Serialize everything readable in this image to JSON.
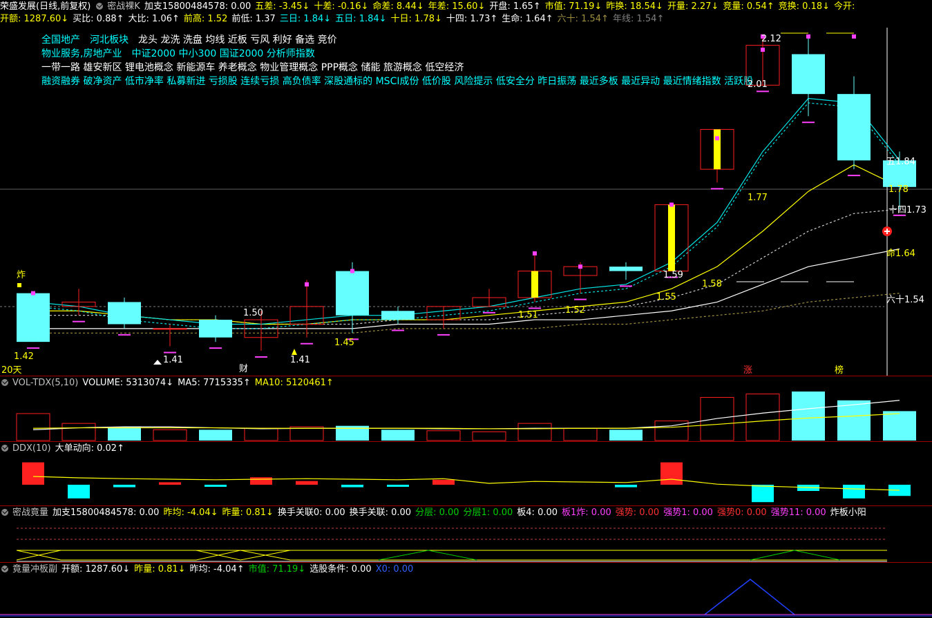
{
  "header": {
    "row1": [
      {
        "t": "荣盛发展(日线,前复权)",
        "c": "#ffffff"
      },
      {
        "icon": "circle"
      },
      {
        "t": "密战裸K",
        "c": "#c0c0c0"
      },
      {
        "t": "加支15800484578: 0.00",
        "c": "#ffffff"
      },
      {
        "t": "五差: -3.45↓",
        "c": "#ffff00"
      },
      {
        "t": "十差: -0.16↓",
        "c": "#ffff00"
      },
      {
        "t": "命差: 8.44↓",
        "c": "#ffff00"
      },
      {
        "t": "年差: 15.60↓",
        "c": "#ffff00"
      },
      {
        "t": "开盘: 1.65↑",
        "c": "#ffffff"
      },
      {
        "t": "市值: 71.19↓",
        "c": "#ffff00"
      },
      {
        "t": "昨换: 18.54↓",
        "c": "#ffff00"
      },
      {
        "t": "开量: 2.27↓",
        "c": "#ffff00"
      },
      {
        "t": "竞量: 0.54↑",
        "c": "#ffff00"
      },
      {
        "t": "竞换: 0.18↓",
        "c": "#ffff00"
      },
      {
        "t": "今开:",
        "c": "#ffff00"
      }
    ],
    "row2": [
      {
        "t": "开额: 1287.60↓",
        "c": "#ffff00"
      },
      {
        "t": "买比: 0.88↑",
        "c": "#ffffff"
      },
      {
        "t": "大比: 1.06↑",
        "c": "#ffffff"
      },
      {
        "t": "前高: 1.52",
        "c": "#ffff00"
      },
      {
        "t": "前低: 1.37",
        "c": "#ffffff"
      },
      {
        "t": "三日: 1.84↓",
        "c": "#00ffff"
      },
      {
        "t": "五日: 1.84↓",
        "c": "#00ffff"
      },
      {
        "t": "十日: 1.78↓",
        "c": "#ffff00"
      },
      {
        "t": "十四: 1.73↑",
        "c": "#ffffff"
      },
      {
        "t": "生命: 1.64↑",
        "c": "#ffffff"
      },
      {
        "t": "六十: 1.54↑",
        "c": "#a09040"
      },
      {
        "t": "年线: 1.54↑",
        "c": "#808080"
      }
    ]
  },
  "concepts": {
    "line1": [
      {
        "t": "全国地产",
        "c": "#00ffff"
      },
      {
        "t": "河北板块",
        "c": "#00ffff"
      },
      {
        "t": "龙头 龙洗 洗盘 均线 近板 亏风 利好 备选 竞价",
        "c": "#ffffff"
      }
    ],
    "line2": [
      {
        "t": "物业服务,房地产业",
        "c": "#00ffff"
      },
      {
        "t": "中证2000 中小300 国证2000 分析师指数",
        "c": "#00ffff"
      }
    ],
    "line3": [
      {
        "t": "一带一路 雄安新区 锂电池概念 新能源车 养老概念 物业管理概念 PPP概念 储能 旅游概念 低空经济",
        "c": "#ffffff"
      }
    ],
    "line4": [
      {
        "t": "融资融券 破净资产 低市净率 私募新进 亏损股 连续亏损 高负债率 深股通标的 MSCI成份 低价股 风险提示 低安全分 昨日振荡 最近多板 最近异动 最近情绪指数 活跃股",
        "c": "#00ffff"
      }
    ]
  },
  "price_chart": {
    "ylim": [
      1.36,
      2.14
    ],
    "candles": [
      {
        "o": 1.54,
        "c": 1.43,
        "h": 1.54,
        "l": 1.43,
        "up": false
      },
      {
        "o": 1.51,
        "c": 1.52,
        "h": 1.55,
        "l": 1.49,
        "up": true,
        "fill": "#66ffff"
      },
      {
        "o": 1.52,
        "c": 1.47,
        "h": 1.53,
        "l": 1.46,
        "fill": "#66ffff"
      },
      {
        "o": 1.46,
        "c": 1.46,
        "h": 1.47,
        "l": 1.42,
        "fill": "#66ffff"
      },
      {
        "o": 1.48,
        "c": 1.44,
        "h": 1.49,
        "l": 1.43,
        "fill": "#66ffff"
      },
      {
        "o": 1.44,
        "c": 1.48,
        "h": 1.5,
        "l": 1.41,
        "up": true
      },
      {
        "o": 1.47,
        "c": 1.51,
        "h": 1.57,
        "l": 1.44,
        "up": true
      },
      {
        "o": 1.59,
        "c": 1.49,
        "h": 1.61,
        "l": 1.45,
        "fill": "#66ffff"
      },
      {
        "o": 1.5,
        "c": 1.48,
        "h": 1.51,
        "l": 1.47,
        "fill": "#66ffff"
      },
      {
        "o": 1.48,
        "c": 1.51,
        "h": 1.51,
        "l": 1.46,
        "up": true
      },
      {
        "o": 1.51,
        "c": 1.53,
        "h": 1.55,
        "l": 1.51,
        "up": true
      },
      {
        "o": 1.53,
        "c": 1.59,
        "h": 1.63,
        "l": 1.52,
        "up": true,
        "bar": "#ffff00"
      },
      {
        "o": 1.58,
        "c": 1.6,
        "h": 1.61,
        "l": 1.54,
        "up": true
      },
      {
        "o": 1.6,
        "c": 1.59,
        "h": 1.61,
        "l": 1.57,
        "fill": "#66ffff"
      },
      {
        "o": 1.59,
        "c": 1.74,
        "h": 1.74,
        "l": 1.59,
        "up": true,
        "bar": "#ffff00"
      },
      {
        "o": 1.82,
        "c": 1.91,
        "h": 1.91,
        "l": 1.79,
        "up": true,
        "bar": "#ffff00"
      },
      {
        "o": 2.01,
        "c": 2.1,
        "h": 2.12,
        "l": 2.01,
        "up": true
      },
      {
        "o": 2.08,
        "c": 1.99,
        "h": 2.12,
        "l": 1.94,
        "fill": "#66ffff"
      },
      {
        "o": 1.99,
        "c": 1.84,
        "h": 2.03,
        "l": 1.82,
        "fill": "#66ffff"
      },
      {
        "o": 1.84,
        "c": 1.78,
        "h": 1.86,
        "l": 1.73,
        "fill": "#66ffff"
      }
    ],
    "ma5": [
      1.52,
      1.51,
      1.49,
      1.48,
      1.47,
      1.47,
      1.48,
      1.49,
      1.49,
      1.5,
      1.51,
      1.53,
      1.55,
      1.56,
      1.61,
      1.7,
      1.86,
      1.98,
      1.97,
      1.84
    ],
    "ma10": [
      1.5,
      1.5,
      1.49,
      1.48,
      1.48,
      1.47,
      1.47,
      1.48,
      1.48,
      1.48,
      1.49,
      1.5,
      1.51,
      1.52,
      1.55,
      1.6,
      1.68,
      1.77,
      1.83,
      1.78
    ],
    "ma14": [
      1.49,
      1.49,
      1.49,
      1.48,
      1.48,
      1.47,
      1.47,
      1.47,
      1.48,
      1.48,
      1.48,
      1.49,
      1.5,
      1.51,
      1.53,
      1.56,
      1.62,
      1.68,
      1.72,
      1.73
    ],
    "ma20": [
      1.46,
      1.46,
      1.46,
      1.46,
      1.46,
      1.46,
      1.46,
      1.46,
      1.47,
      1.47,
      1.47,
      1.48,
      1.48,
      1.49,
      1.5,
      1.52,
      1.56,
      1.6,
      1.62,
      1.64
    ],
    "ma60": [
      1.45,
      1.45,
      1.45,
      1.45,
      1.45,
      1.45,
      1.45,
      1.45,
      1.46,
      1.46,
      1.46,
      1.46,
      1.47,
      1.47,
      1.48,
      1.49,
      1.5,
      1.52,
      1.53,
      1.54
    ],
    "labels": {
      "l_212": "2.12",
      "l_201": "2.01",
      "l_177": "1.77",
      "l_178": "1.78",
      "l_173": "十四1.73",
      "l_164": "命1.64",
      "l_154": "六十1.54",
      "l_159": "1.59",
      "l_158": "1.58",
      "l_155": "1.55",
      "l_152": "1.52",
      "l_151": "1.51",
      "l_150": "1.50",
      "l_145": "1.45",
      "l_142": "1.42",
      "l_141a": "1.41",
      "l_141b": "1.41",
      "l_184": "五1.84",
      "zha": "炸",
      "cai": "财",
      "zhang": "涨",
      "bang": "榜",
      "days": "20天"
    }
  },
  "vol_panel": {
    "title": [
      {
        "icon": "circle"
      },
      {
        "t": "VOL-TDX(5,10)",
        "c": "#c0c0c0"
      },
      {
        "t": "VOLUME: 5313074↓",
        "c": "#ffffff"
      },
      {
        "t": "MA5: 7715335↑",
        "c": "#ffffff"
      },
      {
        "t": "MA10: 5120461↑",
        "c": "#ffff00"
      }
    ],
    "bars": [
      0.55,
      0.35,
      0.28,
      0.22,
      0.22,
      0.25,
      0.28,
      0.3,
      0.22,
      0.2,
      0.18,
      0.35,
      0.25,
      0.22,
      0.4,
      0.88,
      0.95,
      1.0,
      0.82,
      0.6
    ],
    "ma5": [
      0.22,
      0.26,
      0.28,
      0.28,
      0.26,
      0.24,
      0.25,
      0.25,
      0.25,
      0.24,
      0.24,
      0.25,
      0.25,
      0.25,
      0.3,
      0.45,
      0.56,
      0.65,
      0.73,
      0.82
    ],
    "ma10": [
      0.25,
      0.26,
      0.26,
      0.26,
      0.26,
      0.25,
      0.25,
      0.25,
      0.25,
      0.25,
      0.24,
      0.24,
      0.25,
      0.25,
      0.27,
      0.33,
      0.4,
      0.46,
      0.5,
      0.55
    ]
  },
  "ddx_panel": {
    "title": [
      {
        "icon": "circle"
      },
      {
        "t": "DDX(10)",
        "c": "#c0c0c0"
      },
      {
        "t": "大单动向: 0.02↑",
        "c": "#ffffff"
      }
    ],
    "bars": [
      0.9,
      -0.55,
      -0.1,
      0.1,
      -0.05,
      0.3,
      0.15,
      -0.1,
      -0.08,
      0.2,
      0.0,
      0.0,
      0.0,
      -0.1,
      0.9,
      0.0,
      -0.7,
      -0.25,
      -0.55,
      -0.45
    ],
    "line": [
      0.3,
      0.25,
      0.22,
      0.2,
      0.18,
      0.2,
      0.22,
      0.2,
      0.18,
      0.22,
      0.05,
      0.12,
      0.1,
      0.08,
      0.2,
      0.02,
      -0.05,
      -0.1,
      -0.15,
      -0.2
    ]
  },
  "jingliang_panel": {
    "title": [
      {
        "icon": "circle"
      },
      {
        "t": "密战竟量",
        "c": "#c0c0c0"
      },
      {
        "t": "加支15800484578: 0.00",
        "c": "#ffffff"
      },
      {
        "t": "昨均: -4.04↓",
        "c": "#ffff00"
      },
      {
        "t": "昨量: 0.81↓",
        "c": "#ffff00"
      },
      {
        "t": "换手关联0: 0.00",
        "c": "#ffffff"
      },
      {
        "t": "换手关联: 0.00",
        "c": "#ffffff"
      },
      {
        "t": "分层: 0.00",
        "c": "#00d000"
      },
      {
        "t": "分层1: 0.00",
        "c": "#00d000"
      },
      {
        "t": "板4: 0.00",
        "c": "#ffffff"
      },
      {
        "t": "板1炸: 0.00",
        "c": "#ff40ff"
      },
      {
        "t": "强势: 0.00",
        "c": "#ff3030"
      },
      {
        "t": "强势1: 0.00",
        "c": "#ff40ff"
      },
      {
        "t": "强势0: 0.00",
        "c": "#ff3030"
      },
      {
        "t": "强势11: 0.00",
        "c": "#ff40ff"
      },
      {
        "t": "炸板小阳",
        "c": "#ffffff"
      }
    ]
  },
  "chongban_panel": {
    "title": [
      {
        "icon": "circle"
      },
      {
        "t": "竟量冲板副",
        "c": "#c0c0c0"
      },
      {
        "t": "开额: 1287.60↓",
        "c": "#ffffff"
      },
      {
        "t": "昨量: 0.81↓",
        "c": "#ffff00"
      },
      {
        "t": "昨均: -4.04↑",
        "c": "#ffffff"
      },
      {
        "t": "市值: 71.19↓",
        "c": "#00d000"
      },
      {
        "t": "选股条件: 0.00",
        "c": "#ffffff"
      },
      {
        "t": "X0: 0.00",
        "c": "#3060ff"
      }
    ]
  },
  "colors": {
    "up": "#ff2020",
    "down": "#66ffff",
    "ma5": "#00e5e5",
    "ma10": "#ffff00",
    "ma20": "#ffffff",
    "ma60": "#a09040",
    "grid": "#a00000"
  }
}
